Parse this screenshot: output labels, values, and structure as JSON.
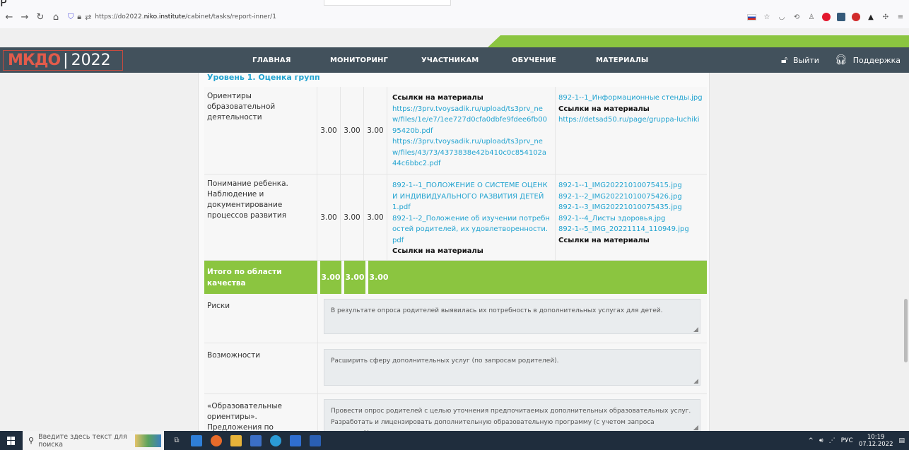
{
  "browser": {
    "tab_fragment": "P",
    "url_prefix": "https://do2022.",
    "url_host": "niko.institute",
    "url_path": "/cabinet/tasks/report-inner/1",
    "icons": [
      "back-icon",
      "forward-icon",
      "reload-icon",
      "home-icon",
      "shield-icon",
      "lock-icon",
      "permissions-icon"
    ]
  },
  "header": {
    "logo_left": "МКДО",
    "logo_sep": "|",
    "logo_right": "2022",
    "menu": [
      "ГЛАВНАЯ",
      "МОНИТОРИНГ",
      "УЧАСТНИКАМ",
      "ОБУЧЕНИЕ",
      "МАТЕРИАЛЫ"
    ],
    "logout": "Выйти",
    "support": "Поддержка",
    "colors": {
      "bar": "#42515c",
      "accent": "#8bc540",
      "logo": "#e25b4b"
    }
  },
  "content": {
    "level_title": "Уровень 1. Оценка групп",
    "rows": [
      {
        "name": "Ориентиры образовательной деятельности",
        "scores": [
          "3.00",
          "3.00",
          "3.00"
        ],
        "m1_bold": "Ссылки на материалы",
        "m1_links": [
          "https://3prv.tvoysadik.ru/upload/ts3prv_new/files/1e/e7/1ee727d0cfa0dbfe9fdee6fb0095420b.pdf",
          "https://3prv.tvoysadik.ru/upload/ts3prv_new/files/43/73/4373838e42b410c0c854102a44c6bbc2.pdf"
        ],
        "m2_link1": "892-1--1_Информационные стенды.jpg",
        "m2_bold": "Ссылки на материалы",
        "m2_link2": "https://detsad50.ru/page/gruppa-luchiki"
      },
      {
        "name": "Понимание ребенка. Наблюдение и документирование процессов развития",
        "scores": [
          "3.00",
          "3.00",
          "3.00"
        ],
        "m1_links": [
          "892-1--1_ПОЛОЖЕНИЕ О СИСТЕМЕ ОЦЕНКИ ИНДИВИДУАЛЬНОГО РАЗВИТИЯ ДЕТЕЙ1.pdf",
          "892-1--2_Положение об изучении потребностей родителей, их удовлетворенности.pdf"
        ],
        "m1_bold": "Ссылки на материалы",
        "m2_links": [
          "892-1--1_IMG20221010075415.jpg",
          "892-1--2_IMG20221010075426.jpg",
          "892-1--3_IMG20221010075435.jpg",
          "892-1--4_Листы здоровья.jpg",
          "892-1--5_IMG_20221114_110949.jpg"
        ],
        "m2_bold": "Ссылки на материалы"
      }
    ],
    "total": {
      "label": "Итого по области качества",
      "scores": [
        "3.00",
        "3.00",
        "3.00"
      ]
    },
    "risks_label": "Риски",
    "risks_text": "В результате опроса родителей выявилась их потребность в дополнительных услугах для детей.",
    "opps_label": "Возможности",
    "opps_text": "Расширить сферу дополнительных услуг  (по запросам родителей).",
    "proposals_label": "«Образовательные ориентиры». Предложения по развитию",
    "proposals_text_1": "Провести опрос родителей с целью уточнения предпочитаемых дополнительных образовательных услуг.",
    "proposals_text_2": "Разработать и лицензировать дополнительную образовательную программу (с учетом запроса родителей)."
  },
  "taskbar": {
    "search_placeholder": "Введите здесь текст для поиска",
    "lang": "РУС",
    "time": "10:19",
    "date": "07.12.2022"
  }
}
